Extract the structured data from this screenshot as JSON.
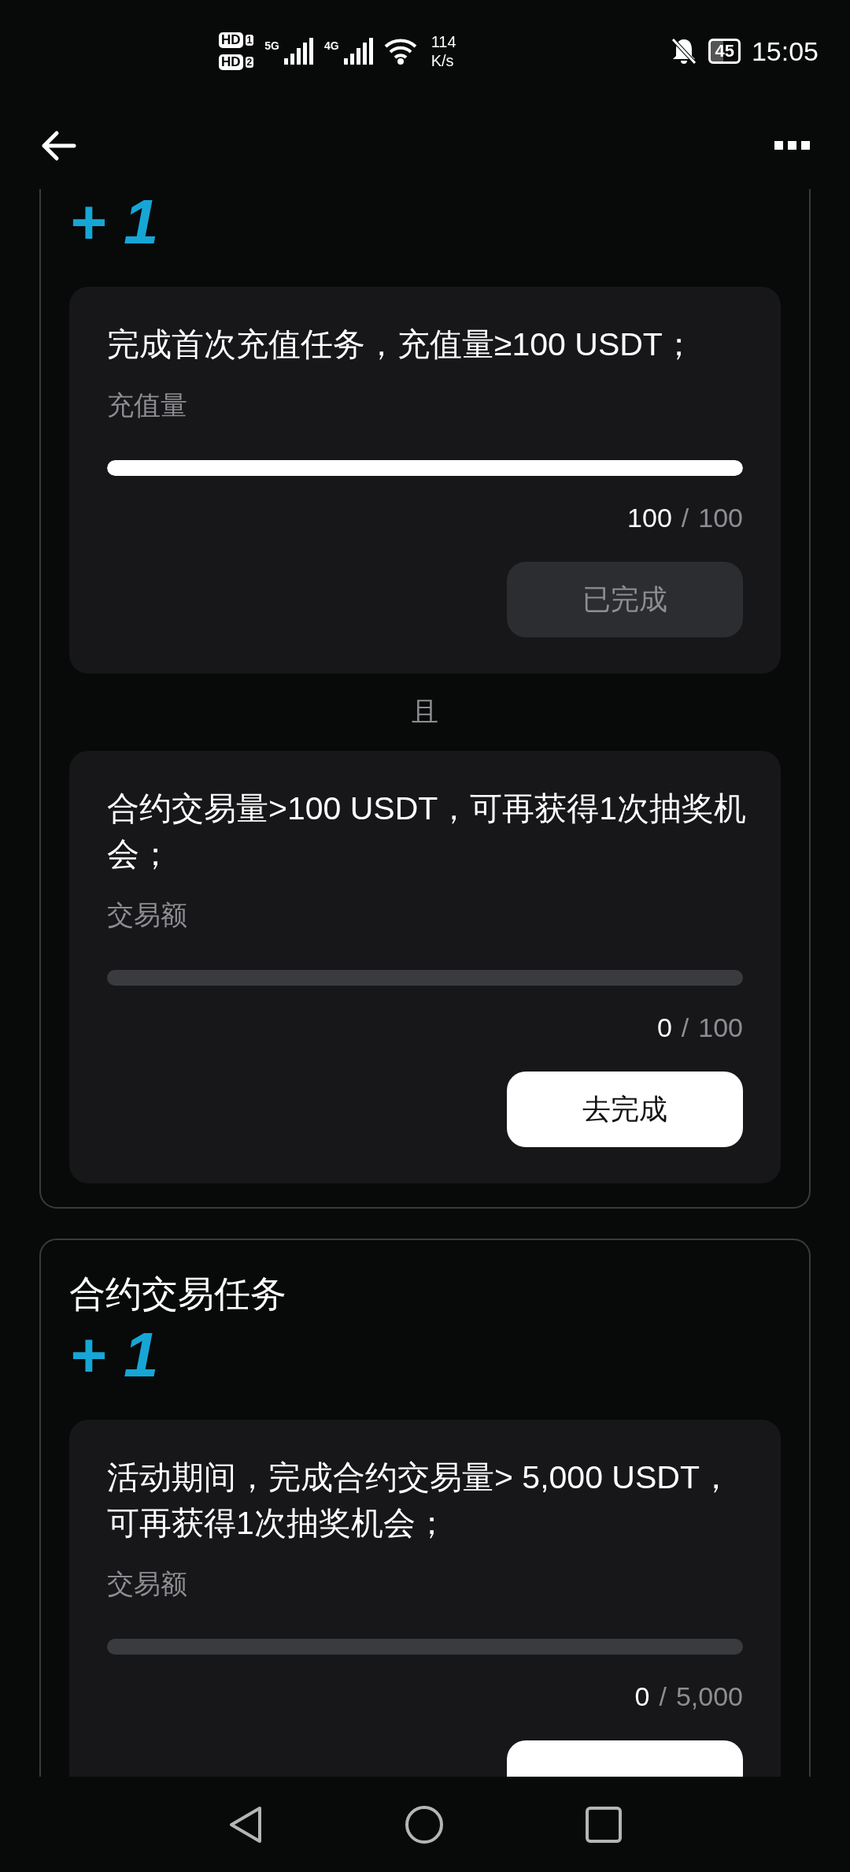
{
  "status_bar": {
    "sims": [
      {
        "badge": "HD",
        "slot": "1",
        "network": "5G"
      },
      {
        "badge": "HD",
        "slot": "2",
        "network": "4G"
      }
    ],
    "speed_value": "114",
    "speed_unit": "K/s",
    "battery": "45",
    "time": "15:05"
  },
  "sections": [
    {
      "reward": "+ 1",
      "items": [
        {
          "description": "完成首次充值任务，充值量≥100 USDT；",
          "metric_label": "充值量",
          "level": 1,
          "current": "100",
          "separator": "/",
          "total": "100",
          "button": {
            "label": "已完成",
            "completed": true
          }
        }
      ],
      "connector": "且",
      "items_after": [
        {
          "description": "合约交易量>100 USDT，可再获得1次抽奖机会；",
          "metric_label": "交易额",
          "level": 0,
          "current": "0",
          "separator": "/",
          "total": "100",
          "button": {
            "label": "去完成",
            "completed": false
          }
        }
      ]
    },
    {
      "title": "合约交易任务",
      "reward": "+ 1",
      "items": [
        {
          "description": "活动期间，完成合约交易量> 5,000 USDT，可再获得1次抽奖机会；",
          "metric_label": "交易额",
          "level": 0,
          "current": "0",
          "separator": "/",
          "total": "5,000",
          "button": {
            "completed": false
          }
        }
      ]
    }
  ]
}
